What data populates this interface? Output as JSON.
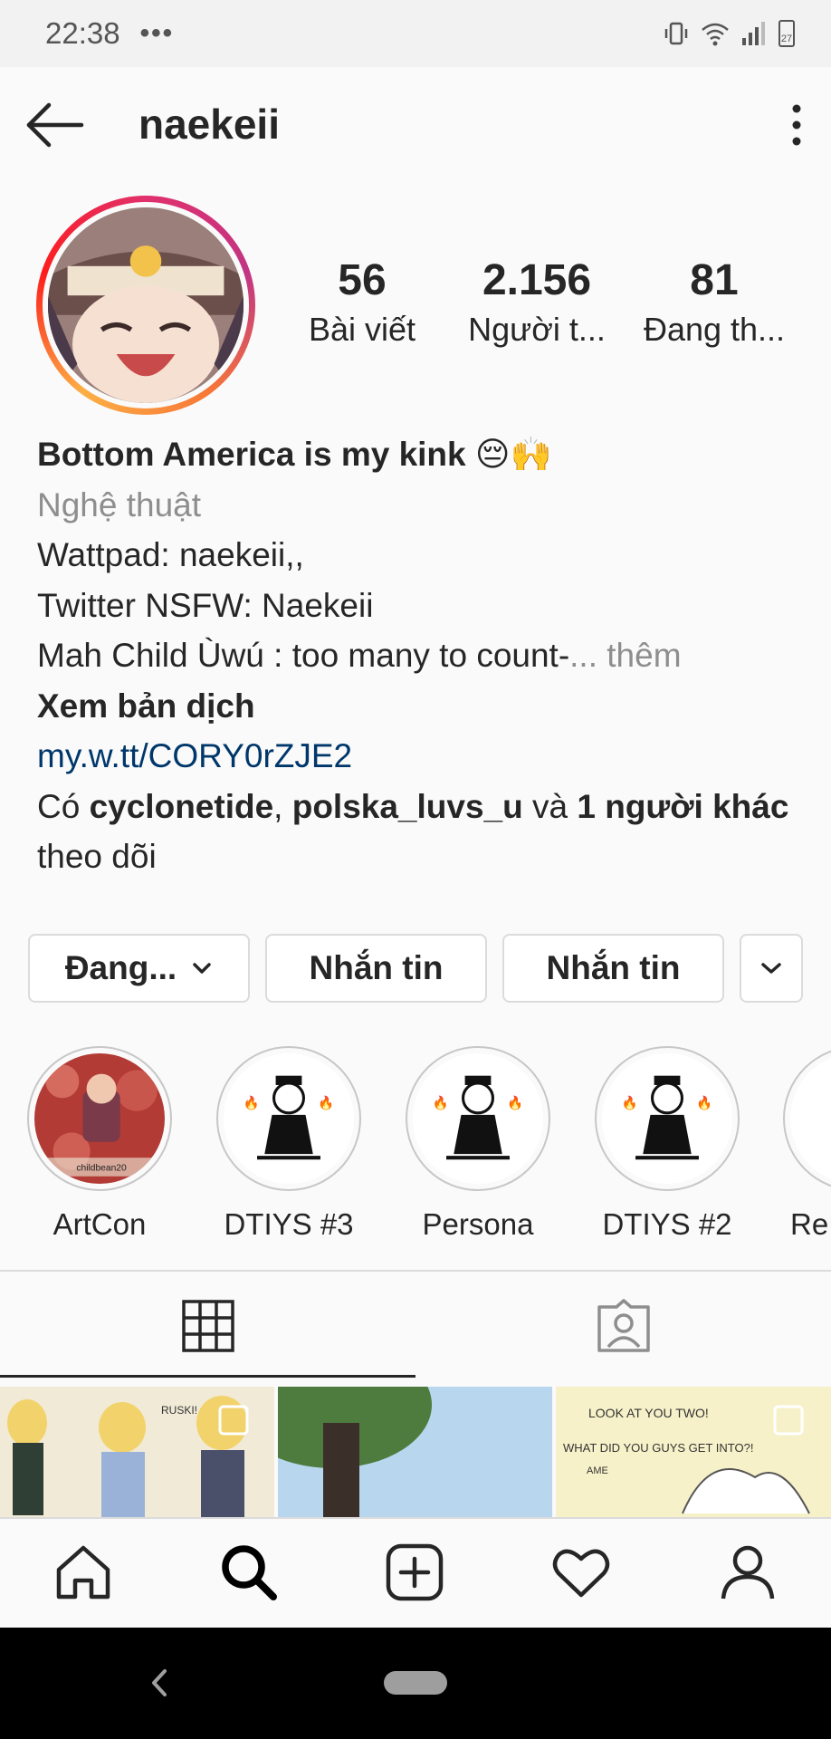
{
  "status_bar": {
    "time": "22:38",
    "overflow": "•••",
    "battery": "27"
  },
  "header": {
    "username": "naekeii"
  },
  "profile": {
    "stats": [
      {
        "value": "56",
        "label": "Bài viết"
      },
      {
        "value": "2.156",
        "label": "Người t..."
      },
      {
        "value": "81",
        "label": "Đang th..."
      }
    ]
  },
  "bio": {
    "name": "Bottom America is my kink 😔🙌",
    "category": "Nghệ thuật",
    "line1": "Wattpad: naekeii,,",
    "line2": "Twitter NSFW: Naekeii",
    "line3": "Mah Child Ùwú : too many to count-",
    "more": "... thêm",
    "translate": "Xem bản dịch",
    "link": "my.w.tt/CORY0rZJE2",
    "followed_by_prefix": "Có ",
    "followed_by_user1": "cyclonetide",
    "followed_by_sep": ", ",
    "followed_by_user2": "polska_luvs_u",
    "followed_by_and": " và ",
    "followed_by_others": "1 người khác",
    "followed_by_suffix": " theo dõi"
  },
  "actions": {
    "following": "Đang...",
    "message1": "Nhắn tin",
    "message2": "Nhắn tin"
  },
  "highlights": [
    {
      "label": "ArtCon"
    },
    {
      "label": "DTIYS #3"
    },
    {
      "label": "Persona"
    },
    {
      "label": "DTIYS #2"
    },
    {
      "label": "Re"
    }
  ],
  "grid_posts": [
    {
      "caption": "RUSKI!"
    },
    {
      "caption": ""
    },
    {
      "caption_line1": "LOOK AT YOU TWO!",
      "caption_line2": "WHAT DID YOU GUYS GET INTO?!",
      "caption_line3": "AME"
    }
  ],
  "highlight_art_text": "childbean20",
  "colors": {
    "link": "#00376b",
    "muted": "#8e8e8e",
    "text": "#262626"
  }
}
